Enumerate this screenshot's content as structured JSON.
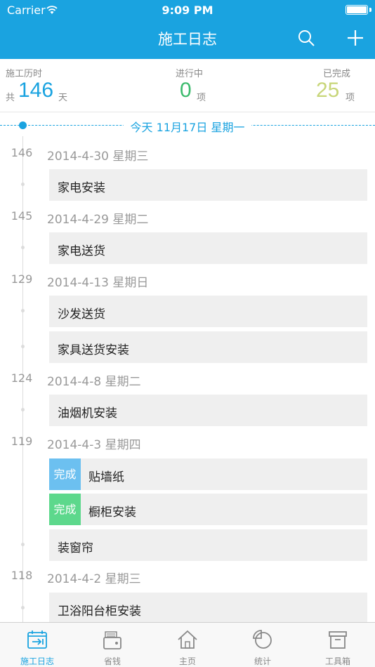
{
  "status_bar": {
    "carrier": "Carrier",
    "time": "9:09 PM"
  },
  "nav": {
    "title": "施工日志",
    "icons": [
      "search-icon",
      "plus-icon"
    ]
  },
  "summary": {
    "elapsed": {
      "label": "施工历时",
      "prefix": "共",
      "value": "146",
      "unit": "天",
      "color": "#1aa3e0"
    },
    "in_progress": {
      "label": "进行中",
      "value": "0",
      "unit": "项",
      "color": "#3dbb6e"
    },
    "completed": {
      "label": "已完成",
      "value": "25",
      "unit": "项",
      "color": "#c8d67a"
    }
  },
  "today": {
    "label": "今天  11月17日  星期一"
  },
  "timeline": [
    {
      "num": "146",
      "date": "2014-4-30 星期三",
      "items": [
        {
          "text": "家电安装",
          "tag": ""
        }
      ]
    },
    {
      "num": "145",
      "date": "2014-4-29 星期二",
      "items": [
        {
          "text": "家电送货",
          "tag": ""
        }
      ]
    },
    {
      "num": "129",
      "date": "2014-4-13 星期日",
      "items": [
        {
          "text": "沙发送货",
          "tag": ""
        },
        {
          "text": "家具送货安装",
          "tag": ""
        }
      ]
    },
    {
      "num": "124",
      "date": "2014-4-8 星期二",
      "items": [
        {
          "text": "油烟机安装",
          "tag": ""
        }
      ]
    },
    {
      "num": "119",
      "date": "2014-4-3 星期四",
      "items": [
        {
          "text": "贴墙纸",
          "tag": "完成",
          "tag_color": "#6cc0f0"
        },
        {
          "text": "橱柜安装",
          "tag": "完成",
          "tag_color": "#5dd88c"
        },
        {
          "text": "装窗帘",
          "tag": ""
        }
      ]
    },
    {
      "num": "118",
      "date": "2014-4-2 星期三",
      "items": [
        {
          "text": "卫浴阳台柜安装",
          "tag": ""
        }
      ]
    }
  ],
  "tabs": [
    {
      "label": "施工日志",
      "icon": "calendar-icon",
      "active": true
    },
    {
      "label": "省钱",
      "icon": "wallet-icon",
      "active": false
    },
    {
      "label": "主页",
      "icon": "home-icon",
      "active": false
    },
    {
      "label": "统计",
      "icon": "pie-chart-icon",
      "active": false
    },
    {
      "label": "工具箱",
      "icon": "toolbox-icon",
      "active": false
    }
  ],
  "colors": {
    "accent": "#1aa3e0",
    "item_bg": "#efefef"
  }
}
